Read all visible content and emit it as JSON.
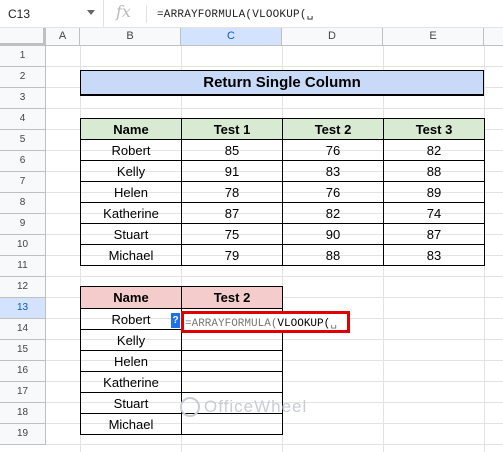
{
  "formula_bar": {
    "name_box": "C13",
    "fx_label": "fx",
    "formula": "=ARRAYFORMULA(VLOOKUP(␣"
  },
  "columns": [
    "A",
    "B",
    "C",
    "D",
    "E"
  ],
  "selected_column": "C",
  "rows": [
    "1",
    "2",
    "3",
    "4",
    "5",
    "6",
    "7",
    "8",
    "9",
    "10",
    "11",
    "12",
    "13",
    "14",
    "15",
    "16",
    "17",
    "18",
    "19"
  ],
  "selected_row": "13",
  "title": "Return Single Column",
  "table1": {
    "headers": [
      "Name",
      "Test 1",
      "Test 2",
      "Test 3"
    ],
    "rows": [
      [
        "Robert",
        "85",
        "76",
        "82"
      ],
      [
        "Kelly",
        "91",
        "83",
        "88"
      ],
      [
        "Helen",
        "78",
        "76",
        "89"
      ],
      [
        "Katherine",
        "87",
        "82",
        "74"
      ],
      [
        "Stuart",
        "75",
        "90",
        "87"
      ],
      [
        "Michael",
        "79",
        "88",
        "83"
      ]
    ]
  },
  "table2": {
    "headers": [
      "Name",
      "Test 2"
    ],
    "names": [
      "Robert",
      "Kelly",
      "Helen",
      "Katherine",
      "Stuart",
      "Michael"
    ]
  },
  "active_cell": {
    "prefix": "=ARRAYFORMULA(",
    "func": "VLOOKUP(",
    "suffix": "␣"
  },
  "fill_handle_label": "?",
  "watermark": "OfficeWheel",
  "colors": {
    "title_bg": "#c9daf8",
    "header1_bg": "#d9ead3",
    "header2_bg": "#f4cccc",
    "active_border": "#e10000",
    "selection": "#d3e3fd"
  }
}
